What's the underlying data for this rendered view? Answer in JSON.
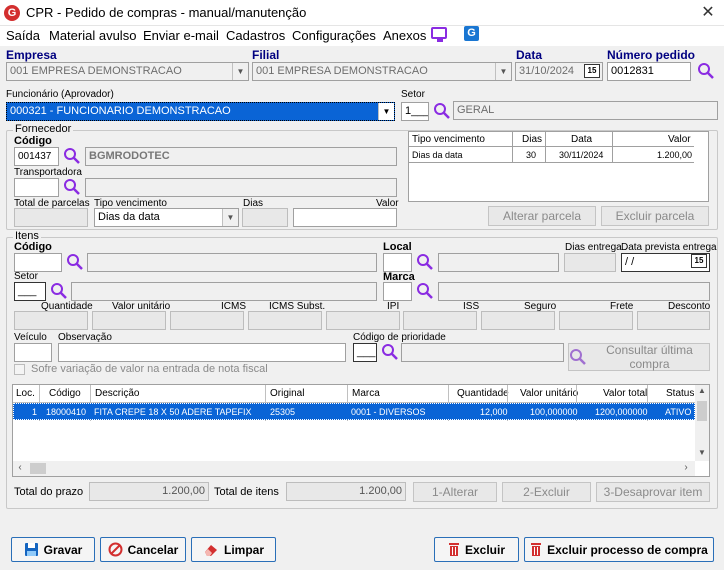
{
  "window": {
    "title": "CPR - Pedido de compras - manual/manutenção",
    "logo_letter": "G",
    "close_glyph": "✕"
  },
  "menu": {
    "items": [
      "Saída",
      "Material avulso",
      "Enviar e-mail",
      "Cadastros",
      "Configurações",
      "Anexos"
    ],
    "app_icon_letter": "G"
  },
  "header": {
    "empresa_label": "Empresa",
    "empresa_value": "001 EMPRESA DEMONSTRACAO",
    "filial_label": "Filial",
    "filial_value": "001 EMPRESA DEMONSTRACAO",
    "data_label": "Data",
    "data_value": "31/10/2024",
    "numero_label": "Número pedido",
    "numero_value": "0012831",
    "calendar_glyph": "15"
  },
  "funcionario": {
    "label": "Funcionário (Aprovador)",
    "value": "000321 - FUNCIONARIO DEMONSTRACAO",
    "setor_label": "Setor",
    "setor_code": "1___",
    "setor_name": "GERAL"
  },
  "fornecedor": {
    "group_title": "Fornecedor",
    "codigo_label": "Código",
    "codigo_value": "001437",
    "nome_value": "BGMRODOTEC",
    "transportadora_label": "Transportadora",
    "total_parcelas_label": "Total de parcelas",
    "tipo_venc_label": "Tipo vencimento",
    "tipo_venc_value": "Dias da data",
    "dias_label": "Dias",
    "valor_label": "Valor",
    "venc_table": {
      "headers": [
        "Tipo vencimento",
        "Dias",
        "Data",
        "Valor"
      ],
      "rows": [
        [
          "Dias da data",
          "30",
          "30/11/2024",
          "1.200,00"
        ]
      ]
    },
    "alterar_parcela": "Alterar parcela",
    "excluir_parcela": "Excluir parcela"
  },
  "itens": {
    "group_title": "Itens",
    "codigo_label": "Código",
    "local_label": "Local",
    "dias_entrega_label": "Dias entrega",
    "data_prevista_label": "Data prevista entrega",
    "data_prevista_value": "/ /",
    "setor_label": "Setor",
    "setor_value": "___",
    "marca_label": "Marca",
    "values_labels": [
      "Quantidade",
      "Valor unitário",
      "ICMS",
      "ICMS Subst.",
      "IPI",
      "ISS",
      "Seguro",
      "Frete",
      "Desconto"
    ],
    "veiculo_label": "Veículo",
    "observacao_label": "Observação",
    "prioridade_label": "Código de prioridade",
    "prioridade_value": "___",
    "sofre_variacao": "Sofre variação de valor na entrada de nota fiscal",
    "consultar_ultima": "Consultar última compra"
  },
  "grid": {
    "headers": [
      "Loc.",
      "Código",
      "Descrição",
      "Original",
      "Marca",
      "Quantidade",
      "Valor unitário",
      "Valor total",
      "Status"
    ],
    "rows": [
      [
        "1",
        "18000410",
        "FITA CREPE 18 X 50 ADERE TAPEFIX",
        "25305",
        "0001 - DIVERSOS",
        "12,000",
        "100,000000",
        "1200,000000",
        "ATIVO"
      ]
    ]
  },
  "totals": {
    "total_prazo_label": "Total do prazo",
    "total_prazo_value": "1.200,00",
    "total_itens_label": "Total de itens",
    "total_itens_value": "1.200,00",
    "alterar": "1-Alterar",
    "excluir": "2-Excluir",
    "desaprovar": "3-Desaprovar item"
  },
  "footer": {
    "gravar": "Gravar",
    "cancelar": "Cancelar",
    "limpar": "Limpar",
    "excluir": "Excluir",
    "excluir_processo": "Excluir processo de compra"
  },
  "colors": {
    "accent": "#000080",
    "selection": "#0a64d6",
    "search_icon": "#8a2be2",
    "danger": "#d32f2f"
  }
}
